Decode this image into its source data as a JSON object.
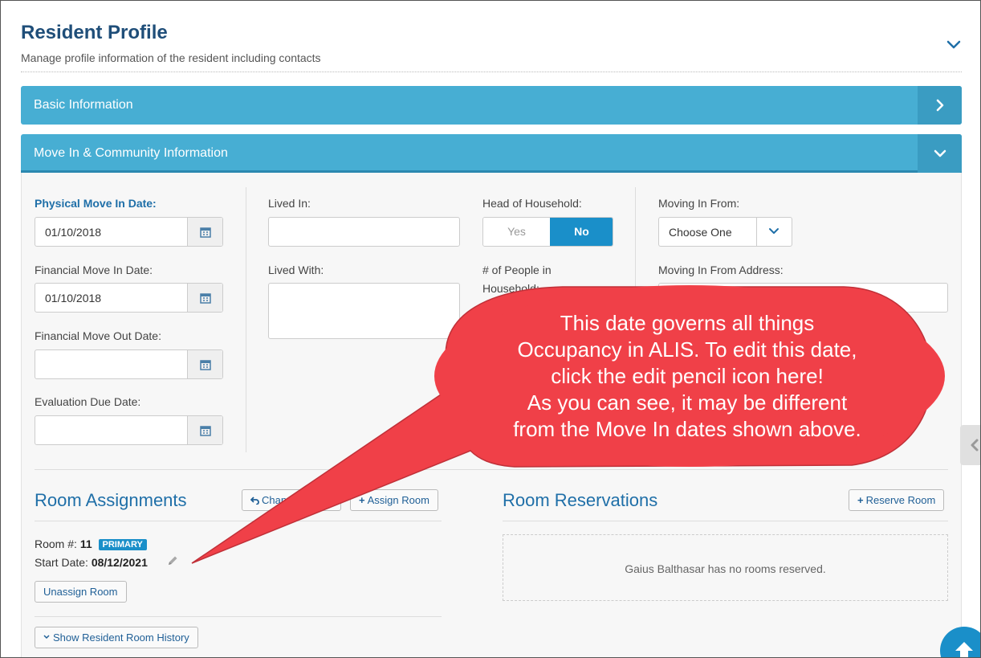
{
  "header": {
    "title": "Resident Profile",
    "subtitle": "Manage profile information of the resident including contacts"
  },
  "panels": [
    {
      "label": "Basic Information",
      "state": "collapsed"
    },
    {
      "label": "Move In & Community Information",
      "state": "expanded"
    }
  ],
  "move_in": {
    "physical_label": "Physical Move In Date:",
    "physical_value": "01/10/2018",
    "financial_in_label": "Financial Move In Date:",
    "financial_in_value": "01/10/2018",
    "financial_out_label": "Financial Move Out Date:",
    "financial_out_value": "",
    "evaluation_label": "Evaluation Due Date:",
    "evaluation_value": "",
    "lived_in_label": "Lived In:",
    "lived_with_label": "Lived With:",
    "head_label": "Head of Household:",
    "head_yes": "Yes",
    "head_no": "No",
    "people_label_1": "# of People in",
    "people_label_2": "Household:",
    "moving_from_label": "Moving In From:",
    "moving_from_value": "Choose One",
    "moving_address_label": "Moving In From Address:"
  },
  "room_assignments": {
    "title": "Room Assignments",
    "change_button": "Change Room",
    "assign_button": "Assign Room",
    "room_label": "Room #:",
    "room_value": "11",
    "badge": "PRIMARY",
    "start_label": "Start Date:",
    "start_value": "08/12/2021",
    "unassign_button": "Unassign Room",
    "history_button": "Show Resident Room History"
  },
  "room_reservations": {
    "title": "Room Reservations",
    "reserve_button": "Reserve Room",
    "empty_text": "Gaius Balthasar has no rooms reserved."
  },
  "callout": {
    "line1": "This date governs all things",
    "line2": "Occupancy in ALIS. To edit this date,",
    "line3": "click the edit pencil icon here!",
    "line4": "As you can see, it may be different",
    "line5": "from the Move In dates shown above."
  },
  "colors": {
    "panel_header": "#47aed3",
    "title_blue": "#1f4e79",
    "accent_blue": "#1a8fc9",
    "callout_red": "#f04048"
  },
  "icons": [
    "chevron-down-icon",
    "chevron-right-icon",
    "calendar-icon",
    "undo-icon",
    "plus-icon",
    "pencil-icon",
    "chevron-left-icon",
    "arrow-up-icon"
  ]
}
